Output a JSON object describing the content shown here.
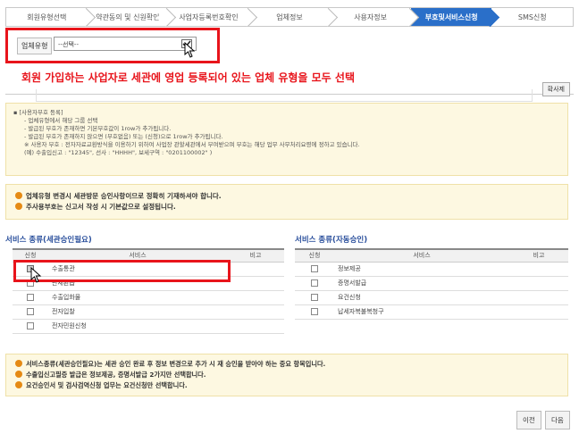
{
  "steps": [
    "회원유형선택",
    "약관동의 및 신원확인",
    "사업자등록번호확인",
    "업체정보",
    "사용자정보",
    "부호및서비스신청",
    "SMS신청"
  ],
  "active_step": 5,
  "select": {
    "label": "업체유형",
    "value": "--선택--"
  },
  "side_button": "확사제",
  "annotation": "회원 가입하는 사업자로 세관에 영업 등록되어 있는 업체 유형을 모두 선택",
  "info1": {
    "heading": "[사용자부호 등록]",
    "lines": [
      "- 업체유형에서 해당 그룹 선택",
      "- 발급된 부호가 존재하면 기본부호값이 1row가 추가됩니다.",
      "- 발급된 부호가 존재하지 않으면 (부호없음) 또는 (신청)으로 1row가 추가됩니다.",
      "※ 사용자 부호 : 전자자료교환방식을 이용하기 위하여 사업장 관할세관에서 부여받으며 부호는 해당 업무 사무처리요령에 정하고 있습니다.",
      "(예) 수출입신고 : \"12345\", 선사 : \"HHHH\", 보세구역 : \"0201100002\" )"
    ]
  },
  "info2": [
    "업체유형 변경시 세관방문 승인사항이므로 정확히 기재하셔야 합니다.",
    "주사용부호는 신고서 작성 시 기본값으로 설정됩니다."
  ],
  "left_table": {
    "title": "서비스 종류(세관승인필요)",
    "headers": [
      "신청",
      "서비스",
      "비고"
    ],
    "rows": [
      {
        "name": "수출통관",
        "checked": true
      },
      {
        "name": "관세환급",
        "checked": false
      },
      {
        "name": "수출입화물",
        "checked": false
      },
      {
        "name": "전자입찰",
        "checked": false
      },
      {
        "name": "전자민원신청",
        "checked": false
      }
    ]
  },
  "right_table": {
    "title": "서비스 종류(자동승인)",
    "headers": [
      "신청",
      "서비스",
      "비고"
    ],
    "rows": [
      {
        "name": "정보제공",
        "checked": false
      },
      {
        "name": "증명서발급",
        "checked": false
      },
      {
        "name": "요건신청",
        "checked": false
      },
      {
        "name": "납세자복불복청구",
        "checked": false
      }
    ]
  },
  "info3": [
    "서비스종류(세관승인필요)는 세관 승인 완료 후 정보 변경으로 추가 시 재 승인을 받아야 하는 중요 항목입니다.",
    "수출입신고필증 발급은 정보제공, 증명서발급 2가지만 선택합니다.",
    "요건승인서 및 검사검역신청 업무는 요건신청만 선택합니다."
  ],
  "buttons": {
    "prev": "이전",
    "next": "다음"
  },
  "colors": {
    "accent": "#2a6fc9",
    "highlight": "#e8141b",
    "notice_bg": "#fdf8e1",
    "dot": "#e58a14"
  }
}
